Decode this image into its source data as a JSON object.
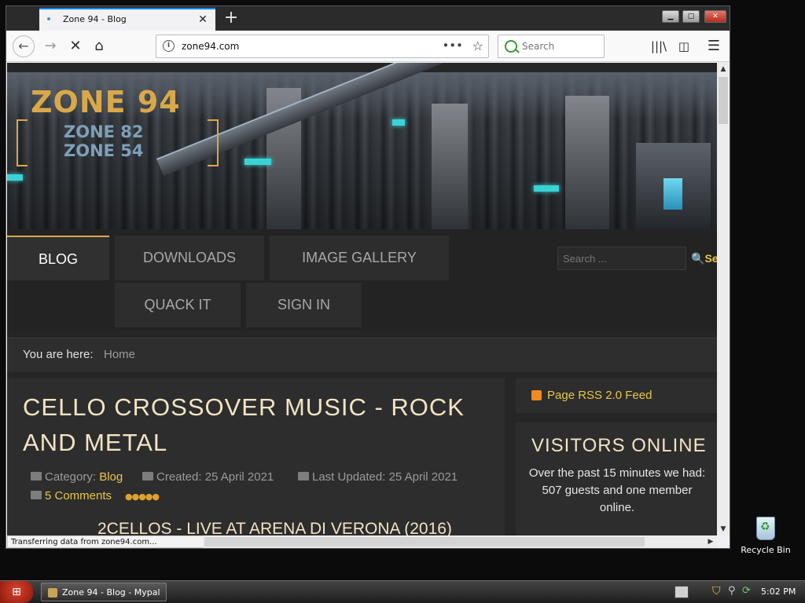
{
  "browser": {
    "tab_title": "Zone 94 - Blog",
    "new_tab_label": "+",
    "url": "zone94.com",
    "search_placeholder": "Search",
    "status_text": "Transferring data from zone94.com..."
  },
  "site": {
    "logo": {
      "main": "ZONE 94",
      "sub1": "ZONE 82",
      "sub2": "ZONE 54"
    },
    "menu": [
      {
        "label": "BLOG",
        "active": true
      },
      {
        "label": "DOWNLOADS"
      },
      {
        "label": "IMAGE GALLERY"
      },
      {
        "label": "QUACK IT"
      },
      {
        "label": "SIGN IN"
      }
    ],
    "search_placeholder": "Search ...",
    "search_button": "Se",
    "breadcrumb": {
      "label": "You are here:",
      "home": "Home"
    },
    "article": {
      "title": "CELLO CROSSOVER MUSIC - ROCK AND METAL",
      "category_label": "Category:",
      "category": "Blog",
      "created": "Created: 25 April 2021",
      "updated": "Last Updated: 25 April 2021",
      "comments": "5 Comments",
      "rating_stars": 5,
      "video_title": "2CELLOS - LIVE AT ARENA DI VERONA (2016)"
    },
    "sidebar": {
      "rss": "Page RSS 2.0 Feed",
      "visitors_title": "VISITORS ONLINE",
      "visitors_text": "Over the past 15 minutes we had: 507 guests and one member online."
    }
  },
  "desktop": {
    "recycle_bin": "Recycle Bin"
  },
  "taskbar": {
    "task_label": "Zone 94 - Blog - Mypal",
    "clock": "5:02 PM"
  },
  "colors": {
    "accent_gold": "#e8c64a",
    "title_cream": "#f2e3c4",
    "tab_indicator": "#0a84ff"
  }
}
